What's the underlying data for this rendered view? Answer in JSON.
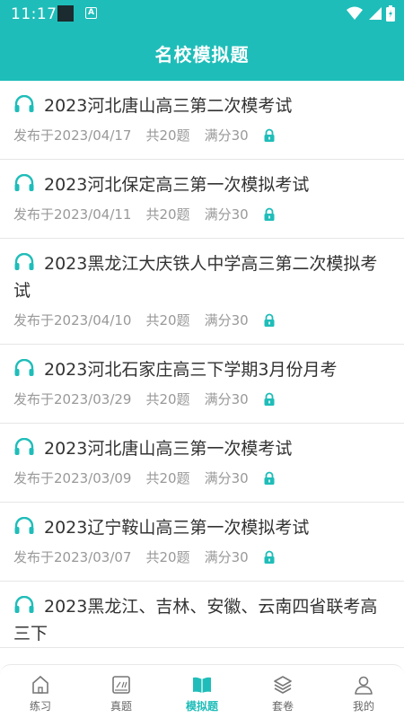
{
  "status": {
    "time": "11:17"
  },
  "header": {
    "title": "名校模拟题"
  },
  "items": [
    {
      "title": "2023河北唐山高三第二次模考试",
      "date": "发布于2023/04/17",
      "count": "共20题",
      "score": "满分30"
    },
    {
      "title": "2023河北保定高三第一次模拟考试",
      "date": "发布于2023/04/11",
      "count": "共20题",
      "score": "满分30"
    },
    {
      "title": "2023黑龙江大庆铁人中学高三第二次模拟考试",
      "date": "发布于2023/04/10",
      "count": "共20题",
      "score": "满分30"
    },
    {
      "title": "2023河北石家庄高三下学期3月份月考",
      "date": "发布于2023/03/29",
      "count": "共20题",
      "score": "满分30"
    },
    {
      "title": "2023河北唐山高三第一次模考试",
      "date": "发布于2023/03/09",
      "count": "共20题",
      "score": "满分30"
    },
    {
      "title": "2023辽宁鞍山高三第一次模拟考试",
      "date": "发布于2023/03/07",
      "count": "共20题",
      "score": "满分30"
    },
    {
      "title": "2023黑龙江、吉林、安徽、云南四省联考高三下",
      "date": "",
      "count": "",
      "score": ""
    }
  ],
  "tabs": [
    {
      "label": "练习",
      "icon": "home-icon"
    },
    {
      "label": "真题",
      "icon": "exam-paper-icon"
    },
    {
      "label": "模拟题",
      "icon": "book-icon",
      "active": true
    },
    {
      "label": "套卷",
      "icon": "layers-icon"
    },
    {
      "label": "我的",
      "icon": "user-icon"
    }
  ],
  "colors": {
    "accent": "#1fbdb9",
    "text": "#333333",
    "meta": "#999999"
  }
}
